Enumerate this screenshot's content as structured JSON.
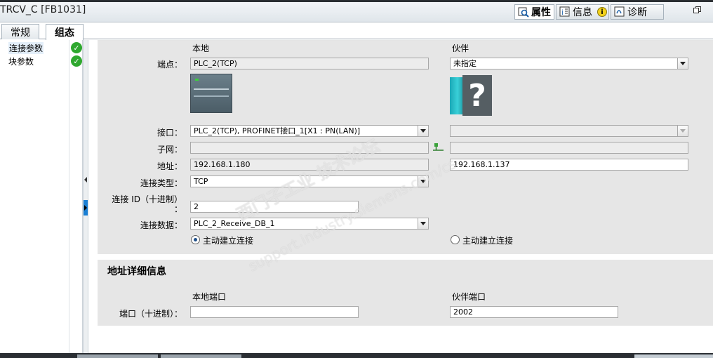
{
  "window": {
    "title": "TRCV_C [FB1031]"
  },
  "right_tabs": [
    {
      "label": "属性",
      "icon": "properties-icon"
    },
    {
      "label": "信息",
      "icon": "info-icon"
    },
    {
      "label": "诊断",
      "icon": "diagnostics-icon"
    }
  ],
  "main_tabs": [
    {
      "label": "常规"
    },
    {
      "label": "组态"
    }
  ],
  "left_nav": {
    "items": [
      {
        "label": "连接参数",
        "status": "ok"
      },
      {
        "label": "块参数",
        "status": "ok"
      }
    ]
  },
  "connection": {
    "header_local": "本地",
    "header_partner": "伙伴",
    "endpoint_label": "端点：",
    "endpoint_local": "PLC_2(TCP)",
    "endpoint_partner": "未指定",
    "interface_label": "接口：",
    "interface_local": "PLC_2(TCP), PROFINET接口_1[X1 : PN(LAN)]",
    "interface_partner": "",
    "subnet_label": "子网：",
    "subnet_local": "",
    "subnet_partner": "",
    "address_label": "地址：",
    "address_local": "192.168.1.180",
    "address_partner": "192.168.1.137",
    "conn_type_label": "连接类型：",
    "conn_type": "TCP",
    "conn_id_label": "连接 ID（十进制）",
    "conn_id_colon": "：",
    "conn_id": "2",
    "conn_data_label": "连接数据：",
    "conn_data": "PLC_2_Receive_DB_1",
    "active_local_label": "主动建立连接",
    "active_local_checked": true,
    "active_partner_label": "主动建立连接",
    "active_partner_checked": false
  },
  "address_details": {
    "title": "地址详细信息",
    "local_port_header": "本地端口",
    "partner_port_header": "伙伴端口",
    "port_label": "端口（十进制）：",
    "local_port": "",
    "partner_port": "2002"
  },
  "watermark": {
    "line1": "西门子工业  技术论坛",
    "line2": "support.industry.siemens.com/cs"
  },
  "colors": {
    "ok": "#2fa82f",
    "panel": "#e6e6e6",
    "accent": "#1a7fd4"
  }
}
